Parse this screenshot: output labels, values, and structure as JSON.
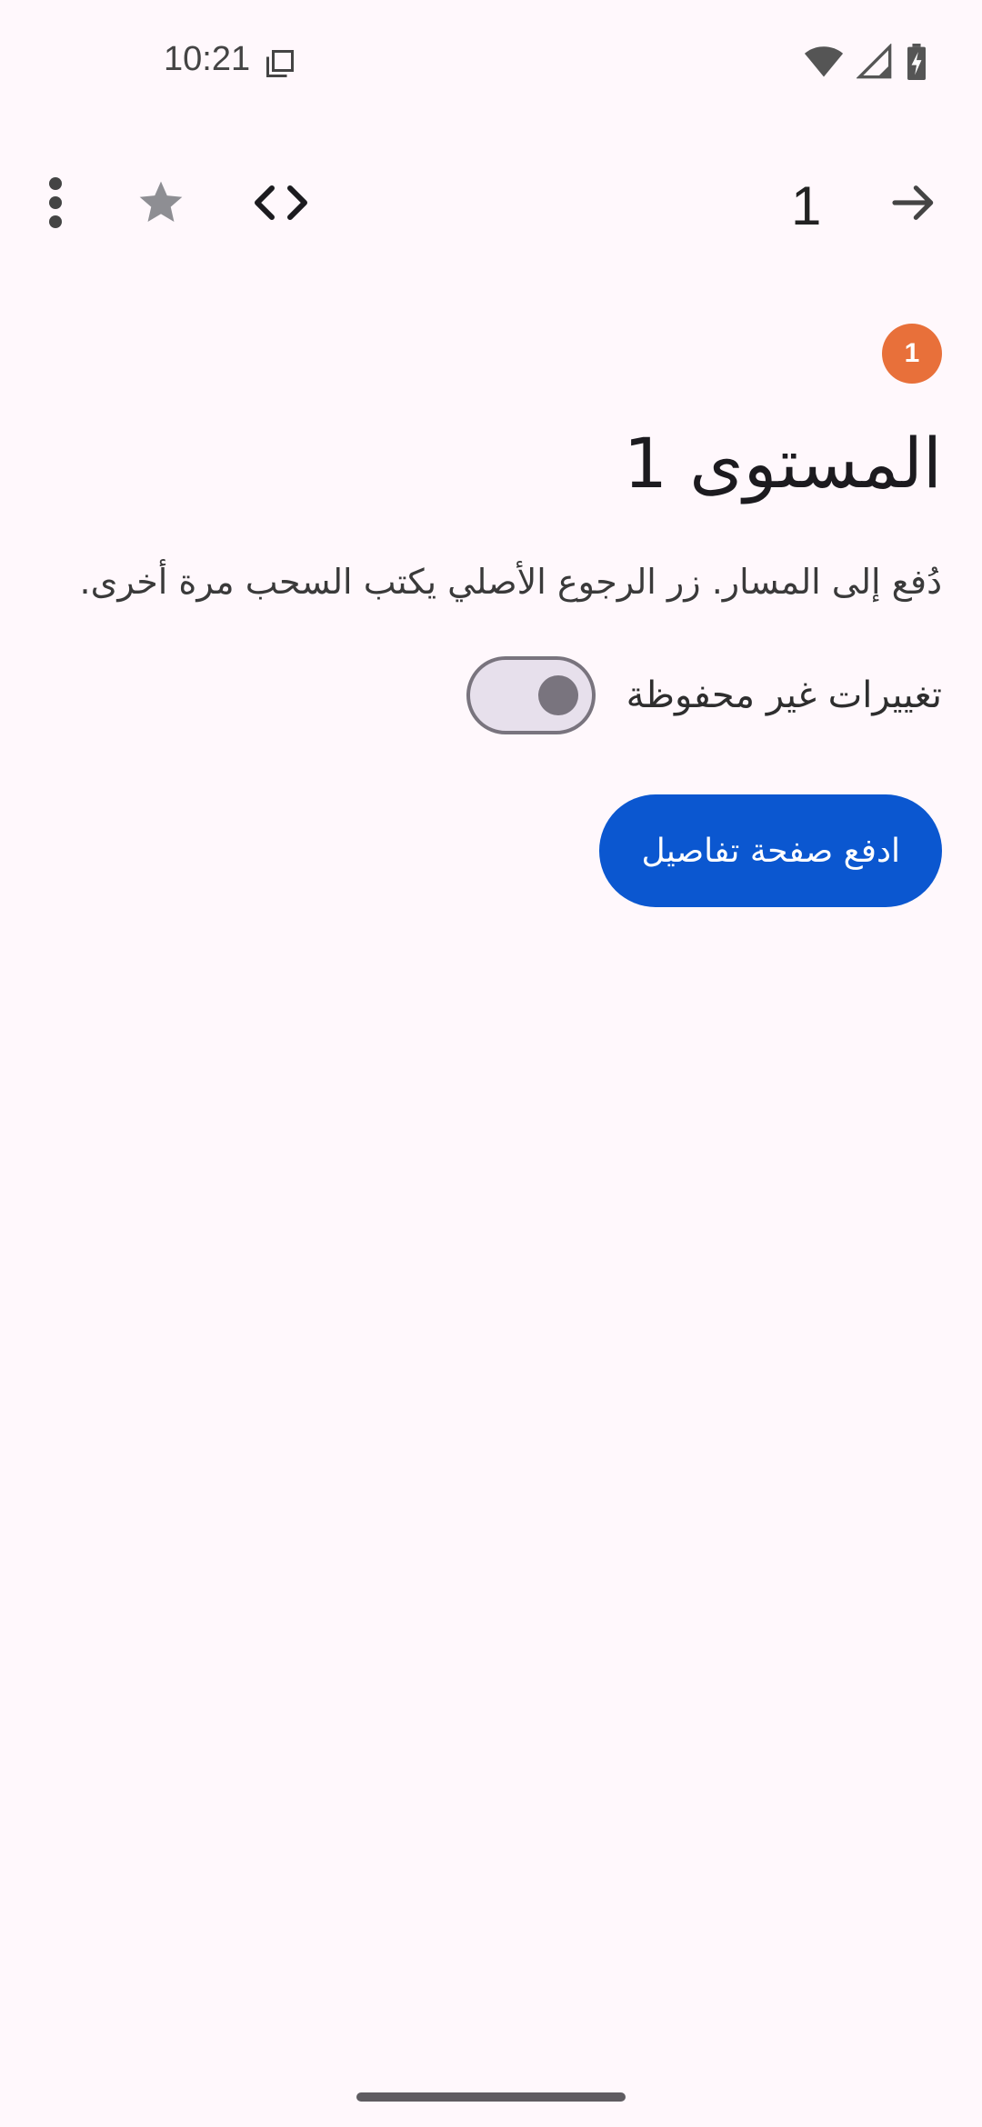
{
  "status_bar": {
    "time": "10:21",
    "icons": [
      "copy-icon",
      "wifi-icon",
      "signal-icon",
      "battery-charging-icon"
    ]
  },
  "toolbar": {
    "more_icon": "more-vertical-icon",
    "star_icon": "star-icon",
    "code_icon": "code-icon",
    "count": "1",
    "forward_icon": "arrow-forward-icon"
  },
  "badge": {
    "value": "1",
    "color": "#E8703A"
  },
  "page": {
    "title": "المستوى 1",
    "description": "دُفع إلى المسار. زر الرجوع الأصلي يكتب السحب مرة أخرى.",
    "switch_label": "تغييرات غير محفوظة",
    "switch_on": false,
    "button_label": "ادفع صفحة تفاصيل",
    "button_color": "#0B57D0"
  }
}
